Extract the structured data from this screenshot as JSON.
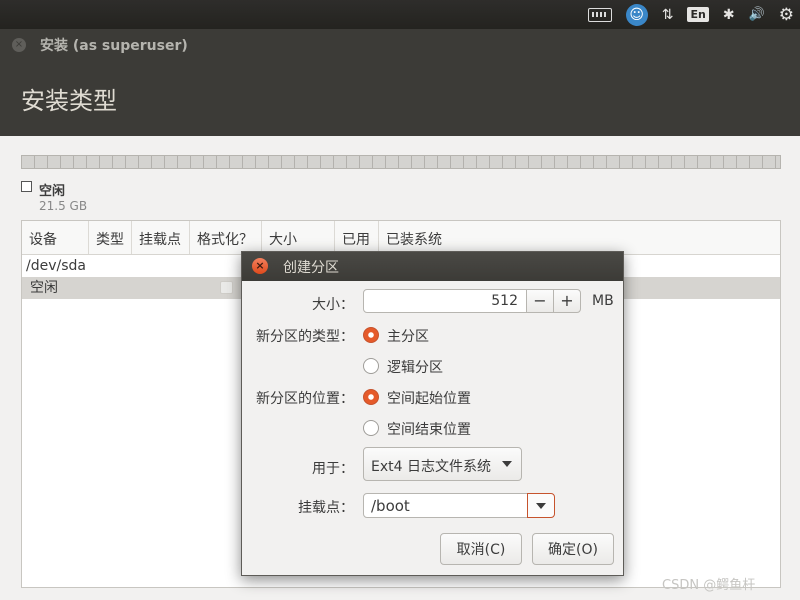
{
  "tray": {
    "keyboard_icon": "keyboard-icon",
    "accessibility_icon": "accessibility-icon",
    "network_icon": "network-icon",
    "network_glyph": "⇅",
    "language": "En",
    "bluetooth_glyph": "✱",
    "volume_glyph": "🔊",
    "settings_glyph": "⚙"
  },
  "window": {
    "close_glyph": "×",
    "title": "安装 (as superuser)"
  },
  "page": {
    "title": "安装类型"
  },
  "partition_legend": {
    "label": "空闲",
    "size": "21.5 GB"
  },
  "table": {
    "columns": [
      "设备",
      "类型",
      "挂载点",
      "格式化？",
      "大小",
      "已用",
      "已装系统"
    ],
    "rows": [
      {
        "device": "/dev/sda"
      },
      {
        "device": "空闲"
      }
    ]
  },
  "dialog": {
    "close_glyph": "×",
    "title": "创建分区",
    "size_label": "大小：",
    "size_value": "512",
    "minus": "−",
    "plus": "+",
    "unit": "MB",
    "type_label": "新分区的类型：",
    "type_options": [
      "主分区",
      "逻辑分区"
    ],
    "type_selected": 0,
    "location_label": "新分区的位置：",
    "location_options": [
      "空间起始位置",
      "空间结束位置"
    ],
    "location_selected": 0,
    "use_label": "用于：",
    "use_value": "Ext4 日志文件系统",
    "mount_label": "挂载点：",
    "mount_value": "/boot",
    "cancel": "取消(C)",
    "ok": "确定(O)"
  },
  "watermark": "CSDN @鳄鱼杆",
  "colors": {
    "accent": "#e55a2a",
    "header": "#3c3b37",
    "panel": "#2b2a28"
  }
}
